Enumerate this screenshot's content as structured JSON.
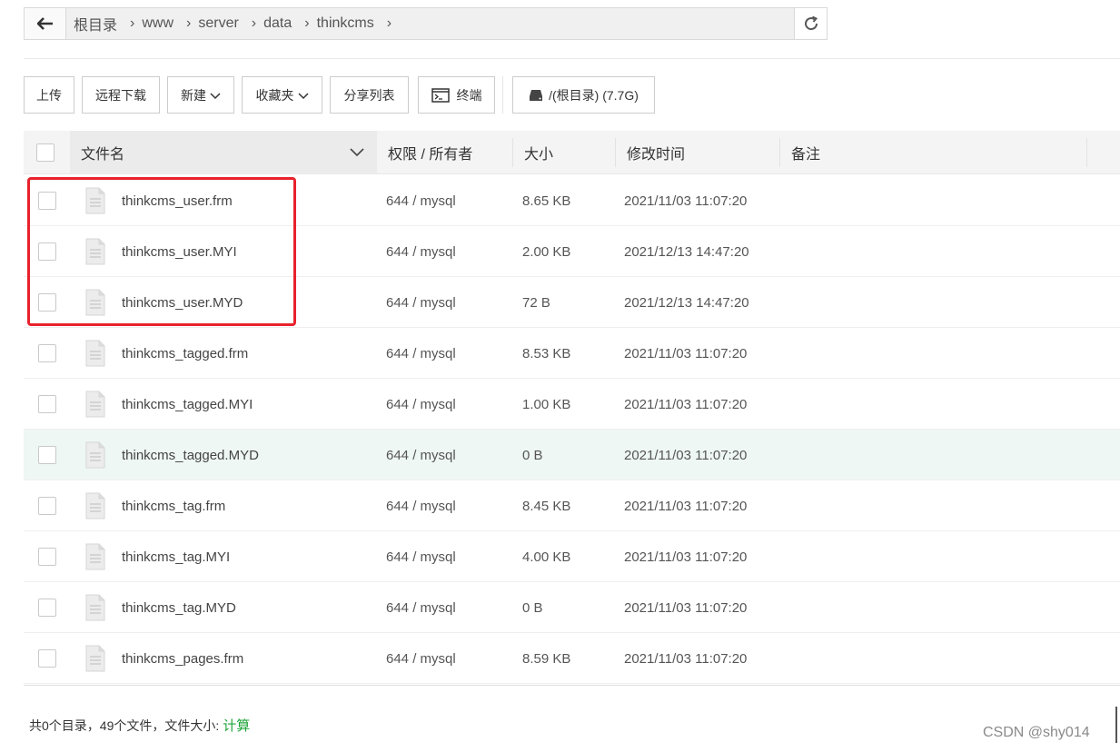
{
  "path": {
    "crumbs": [
      "根目录",
      "www",
      "server",
      "data",
      "thinkcms"
    ]
  },
  "toolbar": {
    "upload": "上传",
    "remote_download": "远程下载",
    "new": "新建",
    "favorites": "收藏夹",
    "share_list": "分享列表",
    "terminal": "终端",
    "disk": "/(根目录) (7.7G)"
  },
  "table": {
    "headers": {
      "name": "文件名",
      "perm": "权限 / 所有者",
      "size": "大小",
      "mtime": "修改时间",
      "note": "备注"
    },
    "rows": [
      {
        "name": "thinkcms_user.frm",
        "perm": "644 / mysql",
        "size": "8.65 KB",
        "mtime": "2021/11/03 11:07:20"
      },
      {
        "name": "thinkcms_user.MYI",
        "perm": "644 / mysql",
        "size": "2.00 KB",
        "mtime": "2021/12/13 14:47:20"
      },
      {
        "name": "thinkcms_user.MYD",
        "perm": "644 / mysql",
        "size": "72 B",
        "mtime": "2021/12/13 14:47:20"
      },
      {
        "name": "thinkcms_tagged.frm",
        "perm": "644 / mysql",
        "size": "8.53 KB",
        "mtime": "2021/11/03 11:07:20"
      },
      {
        "name": "thinkcms_tagged.MYI",
        "perm": "644 / mysql",
        "size": "1.00 KB",
        "mtime": "2021/11/03 11:07:20"
      },
      {
        "name": "thinkcms_tagged.MYD",
        "perm": "644 / mysql",
        "size": "0 B",
        "mtime": "2021/11/03 11:07:20"
      },
      {
        "name": "thinkcms_tag.frm",
        "perm": "644 / mysql",
        "size": "8.45 KB",
        "mtime": "2021/11/03 11:07:20"
      },
      {
        "name": "thinkcms_tag.MYI",
        "perm": "644 / mysql",
        "size": "4.00 KB",
        "mtime": "2021/11/03 11:07:20"
      },
      {
        "name": "thinkcms_tag.MYD",
        "perm": "644 / mysql",
        "size": "0 B",
        "mtime": "2021/11/03 11:07:20"
      },
      {
        "name": "thinkcms_pages.frm",
        "perm": "644 / mysql",
        "size": "8.59 KB",
        "mtime": "2021/11/03 11:07:20"
      }
    ]
  },
  "footer": {
    "summary": "共0个目录，49个文件，文件大小:",
    "calc_link": "计算"
  },
  "watermark": "CSDN @shy014",
  "colors": {
    "accent": "#20a53a",
    "highlight_box": "#e8222c",
    "hover_row": "#eef7f4"
  },
  "highlighted_row_index": 5
}
